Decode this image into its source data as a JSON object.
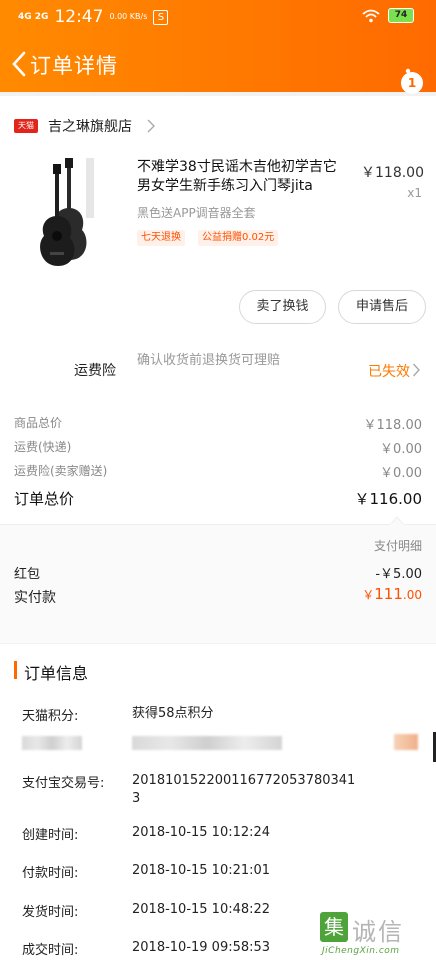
{
  "status_bar": {
    "network": "4G 2G",
    "time": "12:47",
    "speed": "0.00 KB/s",
    "battery": "74"
  },
  "nav": {
    "title": "订单详情",
    "more_badge": "1"
  },
  "shop": {
    "tag": "天猫",
    "name": "吉之琳旗舰店"
  },
  "product": {
    "title": "不难学38寸民谣木吉他初学吉它男女学生新手练习入门琴jita",
    "price": "￥118.00",
    "quantity": "x1",
    "sku": "黑色送APP调音器全套",
    "tags": [
      "七天退换",
      "公益捐赠0.02元"
    ]
  },
  "actions": {
    "sell_label": "卖了换钱",
    "aftersale_label": "申请售后"
  },
  "insurance": {
    "label": "运费险",
    "desc": "确认收货前退换货可理赔",
    "status": "已失效"
  },
  "fees": [
    {
      "label": "商品总价",
      "value": "￥118.00"
    },
    {
      "label": "运费(快递)",
      "value": "￥0.00"
    },
    {
      "label": "运费险(卖家赠送)",
      "value": "￥0.00"
    }
  ],
  "total": {
    "label": "订单总价",
    "value": "￥116.00"
  },
  "payment": {
    "detail_link": "支付明细",
    "red_packet_label": "红包",
    "red_packet_value": "-￥5.00",
    "paid_label": "实付款",
    "paid_currency": "￥",
    "paid_int": "111",
    "paid_dec": ".00"
  },
  "order_info": {
    "title": "订单信息",
    "rows": [
      {
        "label": "天猫积分:",
        "value": "获得58点积分"
      },
      {
        "label": "支付宝交易号:",
        "value": "2018101522001167720537803413"
      },
      {
        "label": "创建时间:",
        "value": "2018-10-15 10:12:24"
      },
      {
        "label": "付款时间:",
        "value": "2018-10-15 10:21:01"
      },
      {
        "label": "发货时间:",
        "value": "2018-10-15 10:48:22"
      },
      {
        "label": "成交时间:",
        "value": "2018-10-19 09:58:53"
      }
    ]
  },
  "watermark": {
    "glyph": "集",
    "chars": "诚信",
    "url": "JiChengXin.com"
  },
  "colors": {
    "brand_orange": "#ff6a00",
    "accent_red": "#ff5000",
    "tmall_red": "#e1251b"
  }
}
